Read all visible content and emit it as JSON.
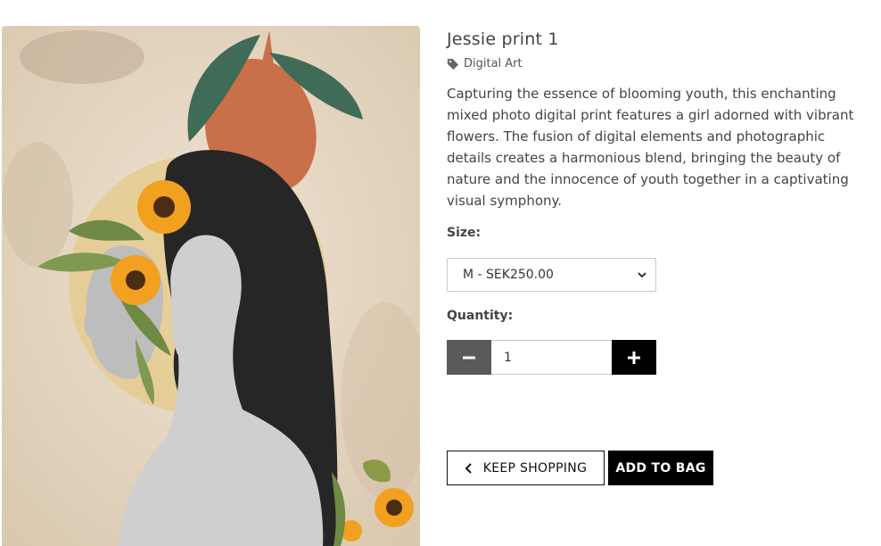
{
  "product": {
    "title": "Jessie print 1",
    "category": "Digital Art",
    "description": "Capturing the essence of blooming youth, this enchanting mixed photo digital print features a girl adorned with vibrant flowers. The fusion of digital elements and photographic details creates a harmonious blend, bringing the beauty of nature and the innocence of youth together in a captivating visual symphony.",
    "image_alt": "Jessie print 1"
  },
  "size": {
    "label": "Size:",
    "selected": "M - SEK250.00"
  },
  "quantity": {
    "label": "Quantity:",
    "value": "1"
  },
  "actions": {
    "keep_shopping": "KEEP SHOPPING",
    "add_to_bag": "ADD TO BAG"
  },
  "icons": {
    "category": "tag-icon",
    "select": "chevron-down-icon",
    "minus": "minus-icon",
    "plus": "plus-icon",
    "back": "chevron-left-icon"
  },
  "colors": {
    "accent": "#000000",
    "minus_button": "#5a5a5a",
    "text": "#444444"
  }
}
